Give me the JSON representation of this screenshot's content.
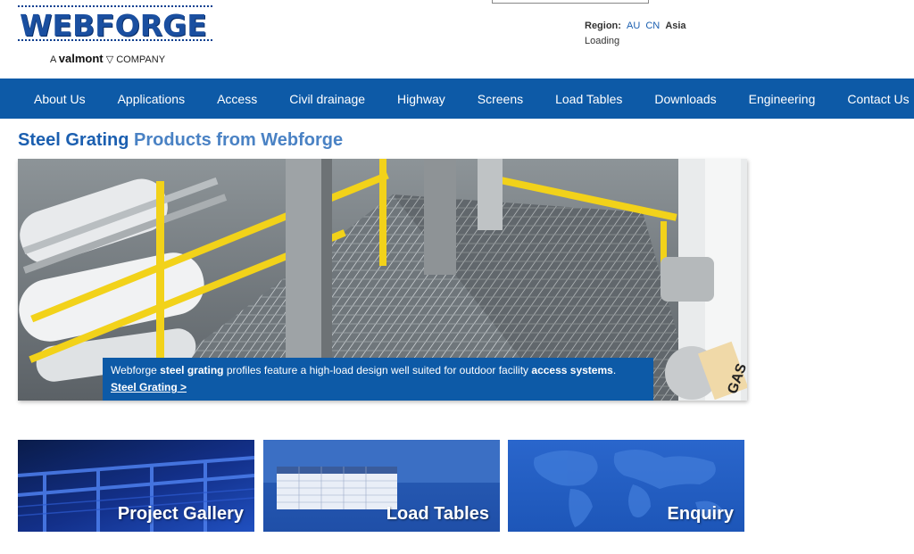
{
  "brand": {
    "logo_text": "WEBFORGE",
    "tagline_prefix": "A",
    "tagline_brand": "valmont",
    "tagline_suffix": "COMPANY"
  },
  "region": {
    "label": "Region:",
    "options": [
      "AU",
      "CN"
    ],
    "current": "Asia",
    "status": "Loading"
  },
  "nav": {
    "items": [
      "About Us",
      "Applications",
      "Access",
      "Civil drainage",
      "Highway",
      "Screens",
      "Load Tables",
      "Downloads",
      "Engineering",
      "Contact Us"
    ]
  },
  "page": {
    "title_strong": "Steel Grating",
    "title_rest": "Products from Webforge"
  },
  "hero": {
    "caption_1": "Webforge",
    "caption_bold_1": "steel grating",
    "caption_2": "profiles feature a high-load design well suited for outdoor facility",
    "caption_bold_2": "access systems",
    "caption_3": ".",
    "link": "Steel Grating >",
    "pipe_label": "GAS"
  },
  "tiles": {
    "gallery": "Project Gallery",
    "load_tables": "Load Tables",
    "enquiry": "Enquiry"
  },
  "colors": {
    "brand_blue": "#0d5aa7",
    "title_blue": "#1b5fb0",
    "rail_yellow": "#f2d21a"
  }
}
